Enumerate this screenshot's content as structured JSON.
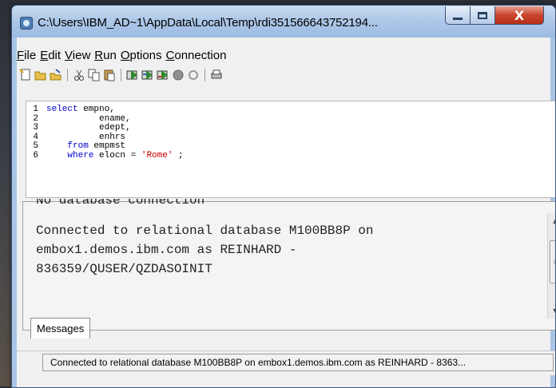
{
  "window": {
    "title": "C:\\Users\\IBM_AD~1\\AppData\\Local\\Temp\\rdi351566643752194...",
    "close_glyph": "X"
  },
  "menu": [
    {
      "underline": "F",
      "rest": "ile"
    },
    {
      "underline": "E",
      "rest": "dit"
    },
    {
      "underline": "V",
      "rest": "iew"
    },
    {
      "underline": "R",
      "rest": "un"
    },
    {
      "underline": "O",
      "rest": "ptions"
    },
    {
      "underline": "C",
      "rest": "onnection"
    }
  ],
  "toolbar_icons": [
    "new-file-icon",
    "open-folder-icon",
    "save-icon",
    "cut-icon",
    "copy-icon",
    "paste-icon",
    "run-sql-icon",
    "run-selected-icon",
    "run-all-icon",
    "stop-icon",
    "cancel-icon",
    "print-icon"
  ],
  "editor": {
    "lines": [
      {
        "num": "1",
        "indent": "",
        "kw": "select",
        "text": " empno,",
        "str": "",
        "tail": ""
      },
      {
        "num": "2",
        "indent": "          ",
        "kw": "",
        "text": "ename,",
        "str": "",
        "tail": ""
      },
      {
        "num": "3",
        "indent": "          ",
        "kw": "",
        "text": "edept,",
        "str": "",
        "tail": ""
      },
      {
        "num": "4",
        "indent": "          ",
        "kw": "",
        "text": "enhrs",
        "str": "",
        "tail": ""
      },
      {
        "num": "5",
        "indent": "    ",
        "kw": "from",
        "text": " empmst",
        "str": "",
        "tail": ""
      },
      {
        "num": "6",
        "indent": "    ",
        "kw": "where",
        "text": " elocn = ",
        "str": "'Rome'",
        "tail": " ;"
      }
    ]
  },
  "messages": {
    "partial_line": "No database connection",
    "text_lines": [
      "Connected to relational database M100BB8P on",
      "embox1.demos.ibm.com as REINHARD -",
      "836359/QUSER/QZDASOINIT"
    ]
  },
  "tabs": [
    {
      "label": "Messages"
    }
  ],
  "status": {
    "text": "Connected to relational database M100BB8P on embox1.demos.ibm.com as REINHARD - 8363..."
  }
}
